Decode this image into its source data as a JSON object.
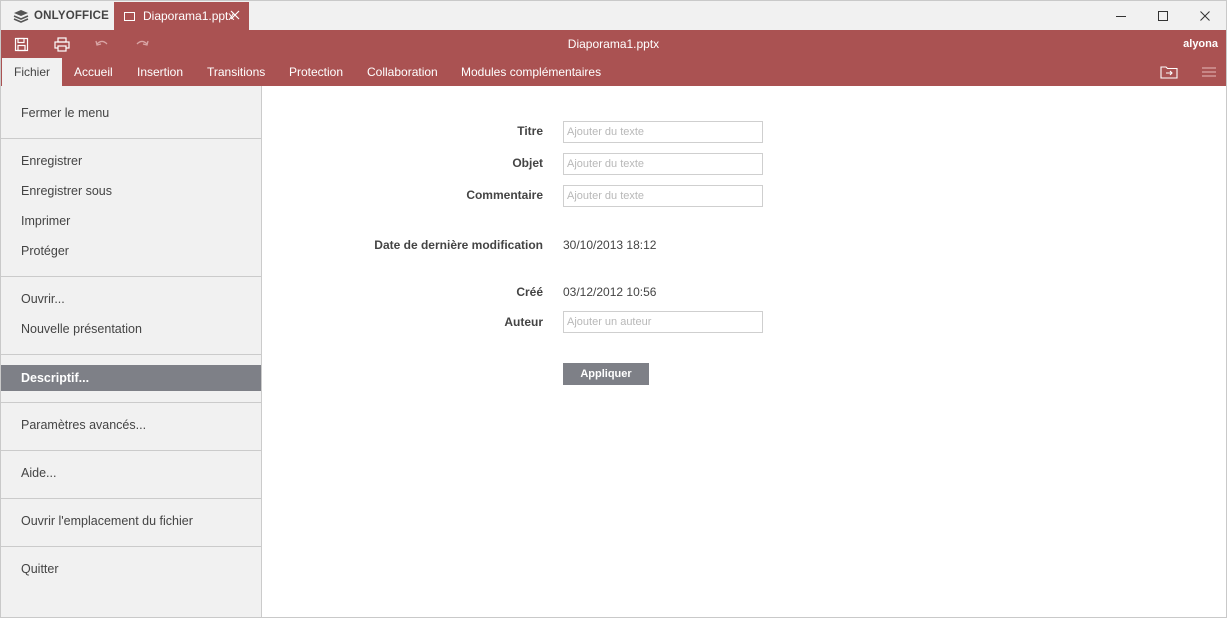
{
  "app": {
    "brand": "ONLYOFFICE",
    "doc_tab_title": "Diaporama1.pptx",
    "window_title": "Diaporama1.pptx",
    "user": "alyona",
    "accent_color": "#aa5252"
  },
  "toolbar": {
    "icons": [
      "save-icon",
      "print-icon",
      "undo-icon",
      "redo-icon"
    ]
  },
  "tabs": [
    {
      "label": "Fichier",
      "active": true
    },
    {
      "label": "Accueil"
    },
    {
      "label": "Insertion"
    },
    {
      "label": "Transitions"
    },
    {
      "label": "Protection"
    },
    {
      "label": "Collaboration"
    },
    {
      "label": "Modules complémentaires"
    }
  ],
  "file_menu": {
    "items": [
      "Fermer le menu",
      "Enregistrer",
      "Enregistrer sous",
      "Imprimer",
      "Protéger",
      "Ouvrir...",
      "Nouvelle présentation",
      "Descriptif...",
      "Paramètres avancés...",
      "Aide...",
      "Ouvrir l'emplacement du fichier",
      "Quitter"
    ],
    "selected": "Descriptif..."
  },
  "info": {
    "title_label": "Titre",
    "title_placeholder": "Ajouter du texte",
    "subject_label": "Objet",
    "subject_placeholder": "Ajouter du texte",
    "comment_label": "Commentaire",
    "comment_placeholder": "Ajouter du texte",
    "modified_label": "Date de dernière modification",
    "modified_value": "30/10/2013 18:12",
    "created_label": "Créé",
    "created_value": "03/12/2012 10:56",
    "author_label": "Auteur",
    "author_placeholder": "Ajouter un auteur",
    "apply_label": "Appliquer"
  }
}
